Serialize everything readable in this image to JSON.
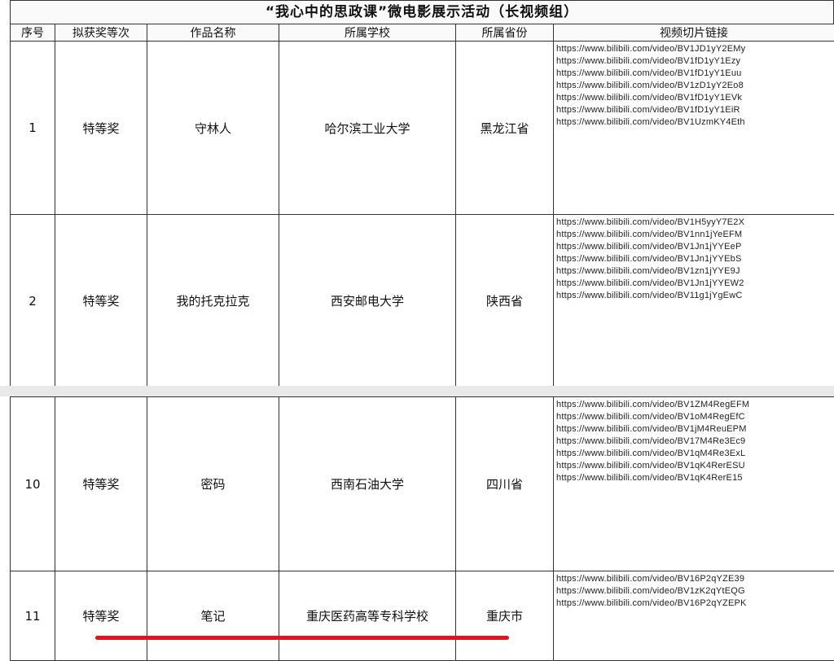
{
  "title": "“我心中的思政课”微电影展示活动（长视频组）",
  "headers": [
    "序号",
    "拟获奖等次",
    "作品名称",
    "所属学校",
    "所属省份",
    "视频切片链接"
  ],
  "block1": [
    {
      "no": "1",
      "award": "特等奖",
      "work": "守林人",
      "school": "哈尔滨工业大学",
      "province": "黑龙江省",
      "links": [
        "https://www.bilibili.com/video/BV1JD1yY2EMy",
        "https://www.bilibili.com/video/BV1fD1yY1Ezy",
        "https://www.bilibili.com/video/BV1fD1yY1Euu",
        "https://www.bilibili.com/video/BV1zD1yY2Eo8",
        "https://www.bilibili.com/video/BV1fD1yY1EVk",
        "https://www.bilibili.com/video/BV1fD1yY1EiR",
        "https://www.bilibili.com/video/BV1UzmKY4Eth"
      ]
    },
    {
      "no": "2",
      "award": "特等奖",
      "work": "我的托克拉克",
      "school": "西安邮电大学",
      "province": "陕西省",
      "links": [
        "https://www.bilibili.com/video/BV1H5yyY7E2X",
        "https://www.bilibili.com/video/BV1nn1jYeEFM",
        "https://www.bilibili.com/video/BV1Jn1jYYEeP",
        "https://www.bilibili.com/video/BV1Jn1jYYEbS",
        "https://www.bilibili.com/video/BV1zn1jYYE9J",
        "https://www.bilibili.com/video/BV1Jn1jYYEW2",
        "https://www.bilibili.com/video/BV11g1jYgEwC"
      ]
    }
  ],
  "block2": [
    {
      "no": "10",
      "award": "特等奖",
      "work": "密码",
      "school": "西南石油大学",
      "province": "四川省",
      "links": [
        "https://www.bilibili.com/video/BV1ZM4RegEFM",
        "https://www.bilibili.com/video/BV1oM4RegEfC",
        "https://www.bilibili.com/video/BV1jM4ReuEPM",
        "https://www.bilibili.com/video/BV17M4Re3Ec9",
        "https://www.bilibili.com/video/BV1qM4Re3ExL",
        "https://www.bilibili.com/video/BV1qK4RerESU",
        "https://www.bilibili.com/video/BV1qK4RerE15"
      ]
    },
    {
      "no": "11",
      "award": "特等奖",
      "work": "笔记",
      "school": "重庆医药高等专科学校",
      "province": "重庆市",
      "links": [
        "https://www.bilibili.com/video/BV16P2qYZE39",
        "https://www.bilibili.com/video/BV1zK2qYtEQG",
        "https://www.bilibili.com/video/BV16P2qYZEPK"
      ]
    }
  ],
  "colors": {
    "underline": "#e0141e"
  }
}
